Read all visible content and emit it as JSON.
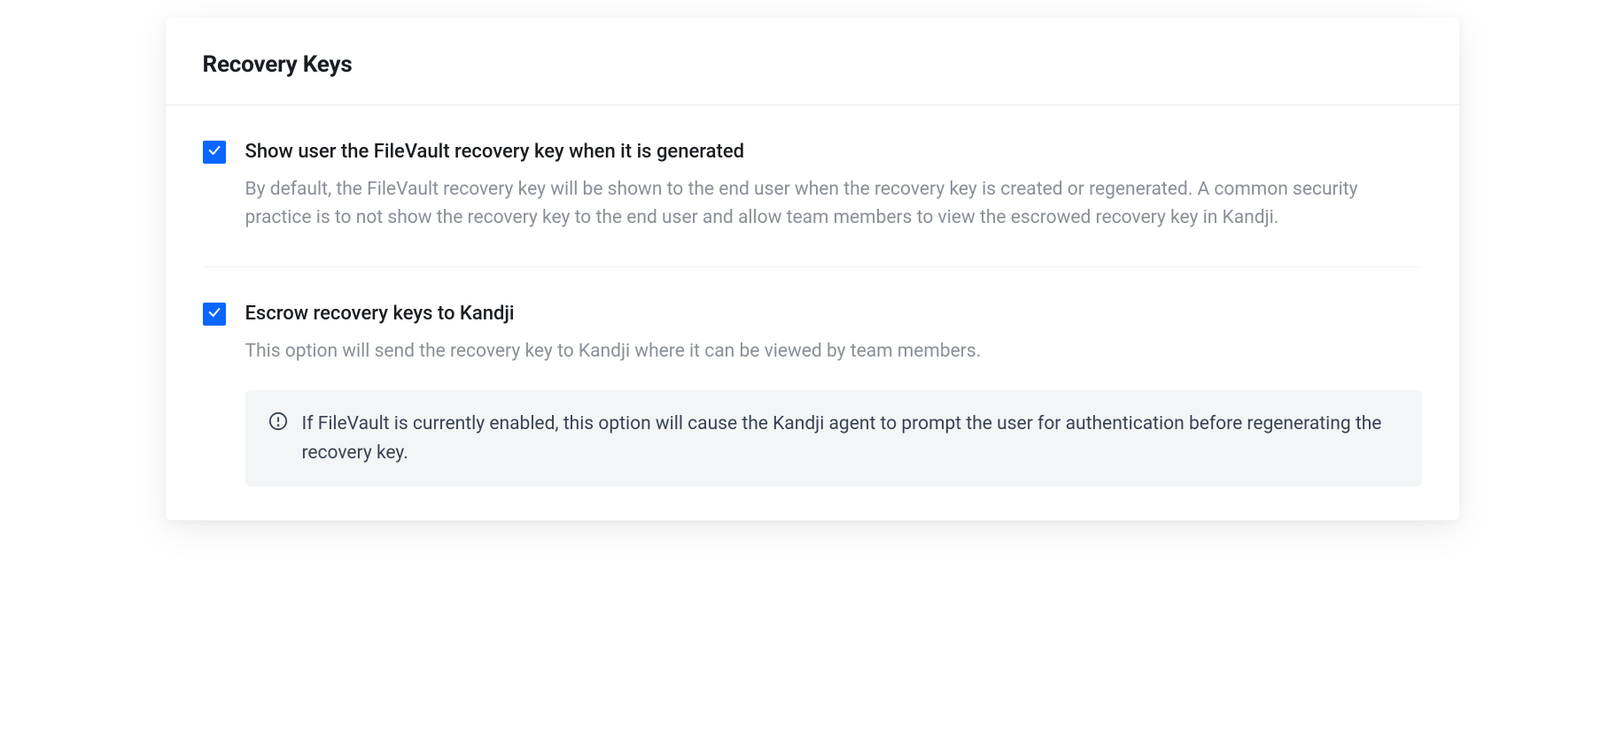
{
  "card": {
    "title": "Recovery Keys",
    "options": [
      {
        "checked": true,
        "label": "Show user the FileVault recovery key when it is generated",
        "description": "By default, the FileVault recovery key will be shown to the end user when the recovery key is created or regenerated. A common security practice is to not show the recovery key to the end user and allow team members to view the escrowed recovery key in Kandji."
      },
      {
        "checked": true,
        "label": "Escrow recovery keys to Kandji",
        "description": "This option will send the recovery key to Kandji where it can be viewed by team members.",
        "info": "If FileVault is currently enabled, this option will cause the Kandji agent to prompt the user for authentication before regenerating the recovery key."
      }
    ]
  }
}
